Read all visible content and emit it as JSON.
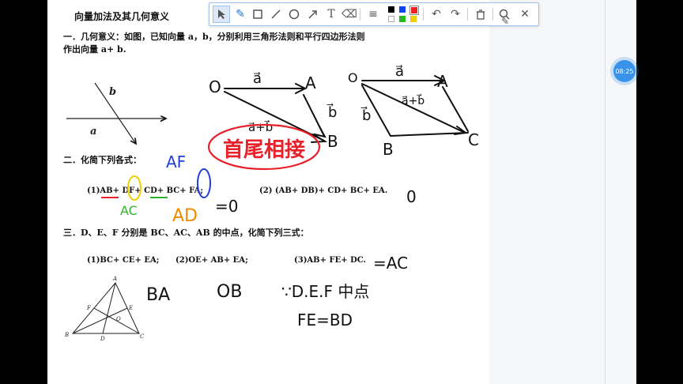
{
  "doc": {
    "title": "向量加法及其几何意义",
    "sec1_line1": "一．几何意义：如图，已知向量 a，b，分别利用三角形法则和平行四边形法则",
    "sec1_line2": "作出向量 a+ b.",
    "sec2": "二．化简下列各式：",
    "ex2_1": "(1)AB+ DF+ CD+ BC+ FA;",
    "ex2_2": "(2) (AB+ DB)+ CD+ BC+ EA.",
    "sec3": "三．D、E、F 分别是 BC、AC、AB 的中点，化简下列三式：",
    "ex3_1": "(1)BC+ CE+ EA;",
    "ex3_2": "(2)OE+ AB+ EA;",
    "ex3_3": "(3)AB+ FE+ DC.",
    "fig_line_a": "a",
    "fig_line_b": "b",
    "tri_A": "A",
    "tri_B": "B",
    "tri_C": "C",
    "tri_D": "D",
    "tri_E": "E",
    "tri_F": "F",
    "tri_O": "O"
  },
  "handwriting": {
    "O1": "O",
    "A1": "A",
    "B1": "B",
    "vec_a1": "a⃗",
    "vec_b1": "b⃗",
    "vec_ab": "a⃗+b⃗",
    "O2": "O",
    "A2": "A",
    "B2": "B",
    "C2": "C",
    "vec_a2": "a⃗",
    "vec_b2": "b⃗",
    "vec_ab2": "a⃗+b⃗",
    "rule": "首尾相接",
    "AF": "AF",
    "AC": "AC",
    "AD": "AD",
    "zero1": "=0",
    "result2": "0",
    "BA": "BA",
    "OB": "OB",
    "mid": "∵D.E.F 中点",
    "FEBD": "FE=BD",
    "eqAC": "=AC"
  },
  "toolbar": {
    "tools": [
      "select-icon",
      "pen-icon",
      "rectangle-icon",
      "line-icon",
      "circle-icon",
      "arrow-icon",
      "text-icon",
      "eraser-icon",
      "line-style-icon"
    ],
    "colors": [
      "#000000",
      "#1144ee",
      "#ee2222",
      "#ffffff",
      "#22bb22",
      "#eecc00"
    ],
    "actions": [
      "undo-icon",
      "redo-icon",
      "delete-icon",
      "search-icon",
      "close-icon"
    ]
  },
  "clock": "08:25",
  "ink_colors": {
    "black": "#111111",
    "red": "#e8202a",
    "blue": "#1f3fd6",
    "green": "#2db52d",
    "yellow": "#f0d000",
    "orange": "#f08a00"
  }
}
